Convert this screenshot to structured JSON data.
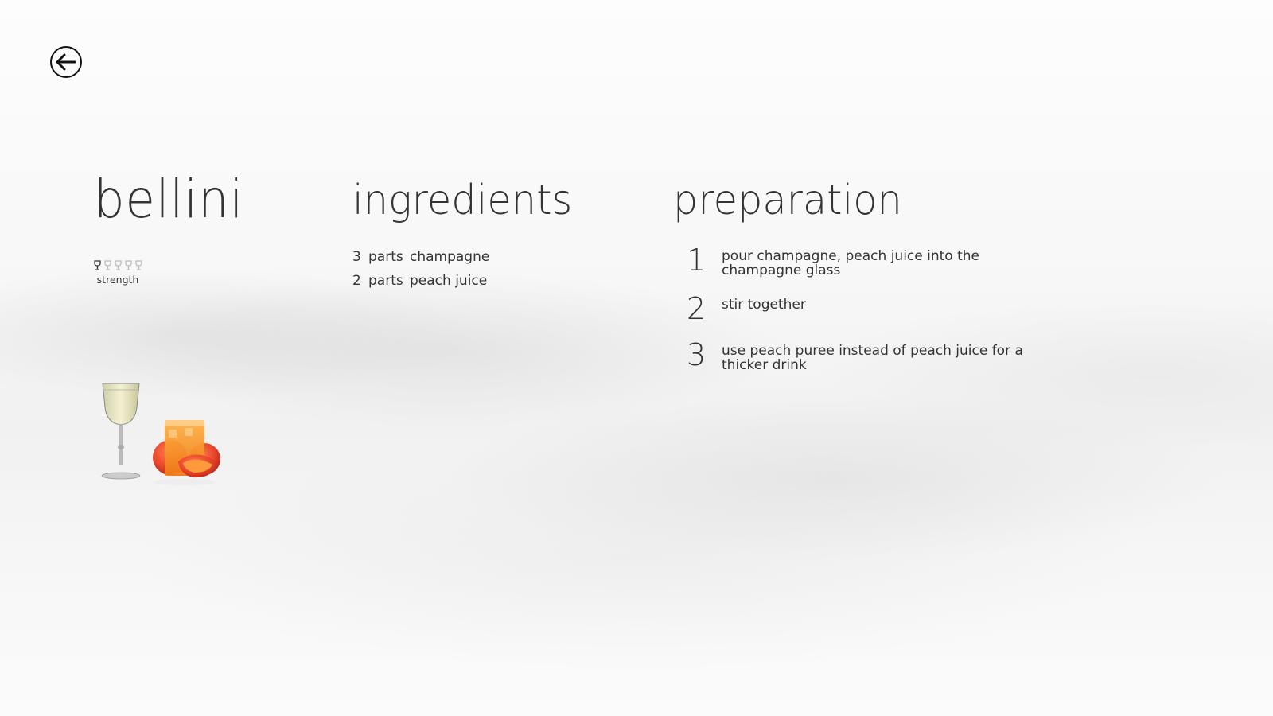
{
  "back": {
    "icon": "back-arrow-icon"
  },
  "drink": {
    "name": "bellini",
    "strength": {
      "level": 1,
      "max": 5,
      "label": "strength",
      "icon": "wine-glass-icon"
    },
    "image": "bellini-champagne-and-peach-juice-illustration"
  },
  "ingredients": {
    "heading": "ingredients",
    "items": [
      {
        "qty": "3",
        "unit": "parts",
        "name": "champagne"
      },
      {
        "qty": "2",
        "unit": "parts",
        "name": "peach juice"
      }
    ]
  },
  "preparation": {
    "heading": "preparation",
    "steps": [
      {
        "number": "1",
        "text": "pour champagne, peach juice into the champagne glass"
      },
      {
        "number": "2",
        "text": "stir together"
      },
      {
        "number": "3",
        "text": "use peach puree instead of peach juice for a thicker drink"
      }
    ]
  },
  "colors": {
    "text": "#333333",
    "glass_active": "#333333",
    "glass_inactive": "#bbbbbb",
    "peach": "#e8542a",
    "juice": "#f7931e"
  }
}
